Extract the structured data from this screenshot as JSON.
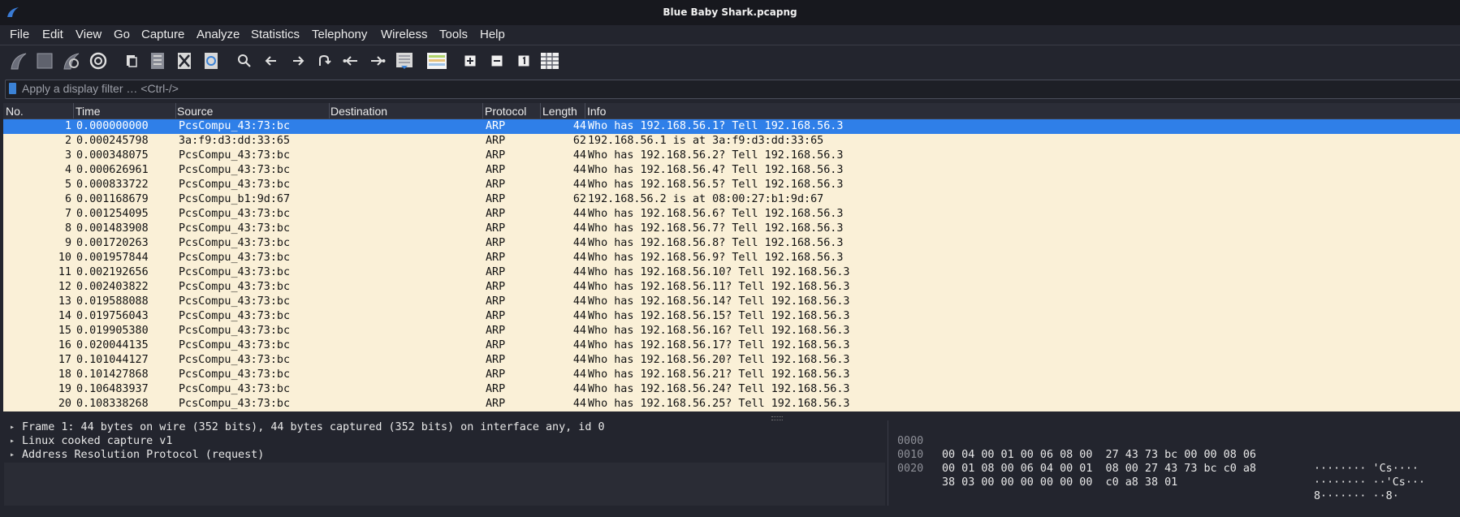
{
  "window": {
    "title": "Blue Baby Shark.pcapng"
  },
  "menu": [
    "File",
    "Edit",
    "View",
    "Go",
    "Capture",
    "Analyze",
    "Statistics",
    "Telephony",
    "Wireless",
    "Tools",
    "Help"
  ],
  "toolbar": [
    "shark-fin-start-icon",
    "stop-square-icon",
    "restart-fin-icon",
    "options-gear-icon",
    "open-file-icon",
    "save-file-icon",
    "close-file-icon",
    "reload-file-icon",
    "find-magnifier-icon",
    "go-back-arrow-icon",
    "go-forward-arrow-icon",
    "go-to-packet-icon",
    "first-packet-icon",
    "last-packet-icon",
    "autoscroll-icon",
    "colorize-icon",
    "zoom-in-icon",
    "zoom-out-icon",
    "normal-size-icon",
    "resize-columns-icon"
  ],
  "filter": {
    "placeholder": "Apply a display filter … <Ctrl-/>"
  },
  "columns": {
    "no": "No.",
    "time": "Time",
    "source": "Source",
    "destination": "Destination",
    "protocol": "Protocol",
    "length": "Length",
    "info": "Info"
  },
  "packets": [
    {
      "no": "1",
      "time": "0.000000000",
      "source": "PcsCompu_43:73:bc",
      "destination": "",
      "protocol": "ARP",
      "length": "44",
      "info": "Who has 192.168.56.1? Tell 192.168.56.3",
      "selected": true
    },
    {
      "no": "2",
      "time": "0.000245798",
      "source": "3a:f9:d3:dd:33:65",
      "destination": "",
      "protocol": "ARP",
      "length": "62",
      "info": "192.168.56.1 is at 3a:f9:d3:dd:33:65"
    },
    {
      "no": "3",
      "time": "0.000348075",
      "source": "PcsCompu_43:73:bc",
      "destination": "",
      "protocol": "ARP",
      "length": "44",
      "info": "Who has 192.168.56.2? Tell 192.168.56.3"
    },
    {
      "no": "4",
      "time": "0.000626961",
      "source": "PcsCompu_43:73:bc",
      "destination": "",
      "protocol": "ARP",
      "length": "44",
      "info": "Who has 192.168.56.4? Tell 192.168.56.3"
    },
    {
      "no": "5",
      "time": "0.000833722",
      "source": "PcsCompu_43:73:bc",
      "destination": "",
      "protocol": "ARP",
      "length": "44",
      "info": "Who has 192.168.56.5? Tell 192.168.56.3"
    },
    {
      "no": "6",
      "time": "0.001168679",
      "source": "PcsCompu_b1:9d:67",
      "destination": "",
      "protocol": "ARP",
      "length": "62",
      "info": "192.168.56.2 is at 08:00:27:b1:9d:67"
    },
    {
      "no": "7",
      "time": "0.001254095",
      "source": "PcsCompu_43:73:bc",
      "destination": "",
      "protocol": "ARP",
      "length": "44",
      "info": "Who has 192.168.56.6? Tell 192.168.56.3"
    },
    {
      "no": "8",
      "time": "0.001483908",
      "source": "PcsCompu_43:73:bc",
      "destination": "",
      "protocol": "ARP",
      "length": "44",
      "info": "Who has 192.168.56.7? Tell 192.168.56.3"
    },
    {
      "no": "9",
      "time": "0.001720263",
      "source": "PcsCompu_43:73:bc",
      "destination": "",
      "protocol": "ARP",
      "length": "44",
      "info": "Who has 192.168.56.8? Tell 192.168.56.3"
    },
    {
      "no": "10",
      "time": "0.001957844",
      "source": "PcsCompu_43:73:bc",
      "destination": "",
      "protocol": "ARP",
      "length": "44",
      "info": "Who has 192.168.56.9? Tell 192.168.56.3"
    },
    {
      "no": "11",
      "time": "0.002192656",
      "source": "PcsCompu_43:73:bc",
      "destination": "",
      "protocol": "ARP",
      "length": "44",
      "info": "Who has 192.168.56.10? Tell 192.168.56.3"
    },
    {
      "no": "12",
      "time": "0.002403822",
      "source": "PcsCompu_43:73:bc",
      "destination": "",
      "protocol": "ARP",
      "length": "44",
      "info": "Who has 192.168.56.11? Tell 192.168.56.3"
    },
    {
      "no": "13",
      "time": "0.019588088",
      "source": "PcsCompu_43:73:bc",
      "destination": "",
      "protocol": "ARP",
      "length": "44",
      "info": "Who has 192.168.56.14? Tell 192.168.56.3"
    },
    {
      "no": "14",
      "time": "0.019756043",
      "source": "PcsCompu_43:73:bc",
      "destination": "",
      "protocol": "ARP",
      "length": "44",
      "info": "Who has 192.168.56.15? Tell 192.168.56.3"
    },
    {
      "no": "15",
      "time": "0.019905380",
      "source": "PcsCompu_43:73:bc",
      "destination": "",
      "protocol": "ARP",
      "length": "44",
      "info": "Who has 192.168.56.16? Tell 192.168.56.3"
    },
    {
      "no": "16",
      "time": "0.020044135",
      "source": "PcsCompu_43:73:bc",
      "destination": "",
      "protocol": "ARP",
      "length": "44",
      "info": "Who has 192.168.56.17? Tell 192.168.56.3"
    },
    {
      "no": "17",
      "time": "0.101044127",
      "source": "PcsCompu_43:73:bc",
      "destination": "",
      "protocol": "ARP",
      "length": "44",
      "info": "Who has 192.168.56.20? Tell 192.168.56.3"
    },
    {
      "no": "18",
      "time": "0.101427868",
      "source": "PcsCompu_43:73:bc",
      "destination": "",
      "protocol": "ARP",
      "length": "44",
      "info": "Who has 192.168.56.21? Tell 192.168.56.3"
    },
    {
      "no": "19",
      "time": "0.106483937",
      "source": "PcsCompu_43:73:bc",
      "destination": "",
      "protocol": "ARP",
      "length": "44",
      "info": "Who has 192.168.56.24? Tell 192.168.56.3"
    },
    {
      "no": "20",
      "time": "0.108338268",
      "source": "PcsCompu_43:73:bc",
      "destination": "",
      "protocol": "ARP",
      "length": "44",
      "info": "Who has 192.168.56.25? Tell 192.168.56.3"
    }
  ],
  "details": [
    "Frame 1: 44 bytes on wire (352 bits), 44 bytes captured (352 bits) on interface any, id 0",
    "Linux cooked capture v1",
    "Address Resolution Protocol (request)"
  ],
  "bytes": [
    {
      "offset": "0000",
      "hex": "00 04 00 01 00 06 08 00  27 43 73 bc 00 00 08 06",
      "ascii": "········ 'Cs····"
    },
    {
      "offset": "0010",
      "hex": "00 01 08 00 06 04 00 01  08 00 27 43 73 bc c0 a8",
      "ascii": "········ ··'Cs···"
    },
    {
      "offset": "0020",
      "hex": "38 03 00 00 00 00 00 00  c0 a8 38 01",
      "ascii": "8······· ··8·"
    }
  ],
  "colors": {
    "selected_row": "#2f7fe8",
    "arp_row": "#faf0d7",
    "background": "#23252e"
  }
}
